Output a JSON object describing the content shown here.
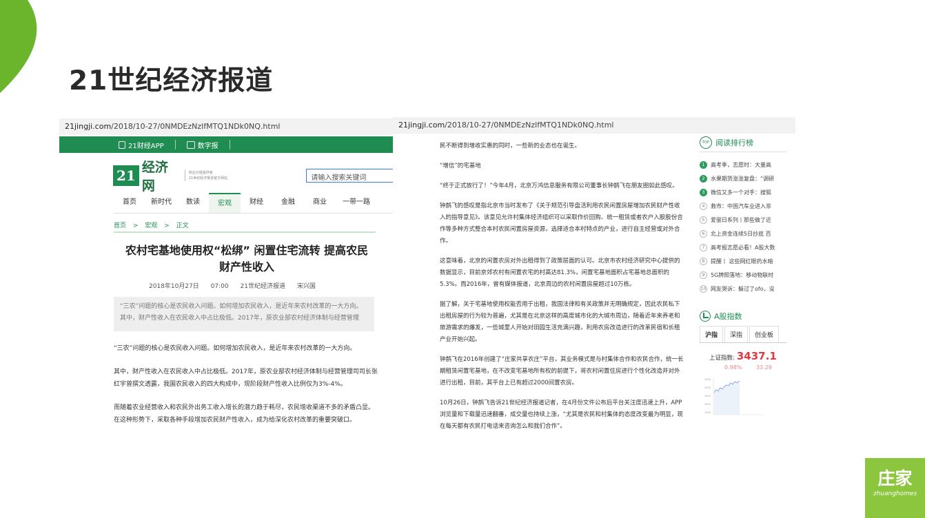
{
  "colors": {
    "accent_green": "#1f8d52",
    "corner_green": "#6bb52d",
    "brand_green": "#8cc63f",
    "index_red": "#e0393e"
  },
  "slide": {
    "title": "21世纪经济报道"
  },
  "left_shot": {
    "url_domain": "21jingji.com",
    "url_path": "/2018/10-27/0NMDEzNzlfMTQ1NDk0NQ.html",
    "topbar": {
      "app_label": "21财经APP",
      "paper_label": "数字报",
      "app_icon": "phone-icon",
      "paper_icon": "newspaper-icon"
    },
    "logo": {
      "mark": "21",
      "text": "经济网",
      "sub_line1": "商业价值提供者",
      "sub_line2": "21世纪经济报道官方网站"
    },
    "search": {
      "placeholder": "请输入搜索关键词"
    },
    "nav": [
      "首页",
      "新时代",
      "数读",
      "宏观",
      "财经",
      "金融",
      "商业",
      "一带一路"
    ],
    "nav_active": "宏观",
    "breadcrumb": [
      "首页",
      ">",
      "宏观",
      ">",
      "正文"
    ],
    "article": {
      "title": "农村宅基地使用权“松绑” 闲置住宅流转 提高农民财产性收入",
      "date": "2018年10月27日",
      "time": "07:00",
      "source": "21世纪经济报道",
      "author": "宋兴国",
      "summary": "“三农”问题的核心是农民收入问题。如何增加农民收入，是近年来农村改革的一大方向。其中，财产性收入在农民收入中占比极低。2017年，原农业部农村经济体制与经营管理",
      "paragraphs": [
        "“三农”问题的核心是农民收入问题。如何增加农民收入，是近年来农村改革的一大方向。",
        "其中，财产性收入在农民收入中占比极低。2017年，原农业部农村经济体制与经营管理司司长张红宇曾撰文透露，我国农民收入的四大构成中，现阶段财产性收入比例仅为3%-4%。",
        "而随着农业经营收入和农民外出务工收入增长的潜力趋于耗尽，农民增收渠道不多的矛盾凸显。在这种形势下，采取各种手段增加农民财产性收入，成为给深化农村改革的重要突破口。"
      ]
    }
  },
  "right_shot": {
    "url_domain": "21jingji.com",
    "url_path": "/2018/10-27/0NMDEzNzlfMTQ1NDk0NQ.html",
    "paragraphs": [
      "民不断得到增收实惠的同时，一些新的业态也在诞生。",
      "“增信”的宅基地",
      "“终于正式放行了！”今年4月，北京万鸿信息服务有限公司董事长钟鹊飞在朋友圈如此感叹。",
      "钟鹊飞的感叹是指北京市当时发布了《关于规范引导盘活利用农民闲置房屋增加农民财产性收入的指导意见》。该意见允许村集体经济组织可以采取作价回购、统一租赁或者农户入股股份合作等多种方式整合本村农民闲置房屋资源，选择适合本村特点的产业，进行自主经营或对外合作。",
      "这意味着，北京的闲置农房对外出租得到了政策层面的认可。北京市农村经济研究中心提供的数据显示，目前京郊农村有闲置农宅的村高达81.3%，闲置宅基地面积占宅基地总面积的5.3%。而2016年，曾有媒体报道，北京周边的农村闲置房屋超过10万栋。",
      "据了解，关于宅基地使用权能否用于出租，我国法律和有关政策并无明确规定，因此农民私下出租房屋的行为较为普遍，尤其是在北京这样的高度城市化的大城市周边，随着近年来养老和旅游需求的爆发，一些城里人开始对田园生活充满兴趣，利用农房改造进行的改革民宿和长租产业开始兴起。",
      "钟鹊飞在2016年创建了“庄家共享农庄”平台，其业务模式是与村集体合作和农民合作，统一长期租赁闲置宅基地，在不改变宅基地所有权的前提下，将农村闲置住房进行个性化改造并对外进行出租，目前，其平台上已有超过2000间置农房。",
      "10月26日，钟鹊飞告诉21世纪经济报道记者，在4月份文件公布后平台关注度迅速上升，APP浏览量和下载量迅速翻番，成交量也持续上涨，“尤其是农民和村集体的态度改变最为明显，现在每天都有农民打电话来咨询怎么和我们合作”。"
    ],
    "sidebar": {
      "rank_icon_text": "TOP",
      "rank_title": "阅读排行榜",
      "ranks": [
        {
          "no": "1",
          "text": "高考季，志愿时：大量高"
        },
        {
          "no": "2",
          "text": "水果期货涨涨复盘：“调研"
        },
        {
          "no": "3",
          "text": "微信又多一个对手：搜狐"
        },
        {
          "no": "4",
          "text": "救市：中国汽车业进入非"
        },
        {
          "no": "5",
          "text": "爱丽日系列丨那些做了近"
        },
        {
          "no": "6",
          "text": "北上资金连续5日抄底 百"
        },
        {
          "no": "7",
          "text": "高考报志愿必看！A股大数"
        },
        {
          "no": "8",
          "text": "提醒丨 这些网红眼药水暗"
        },
        {
          "no": "9",
          "text": "5G牌照落地：移动物联时"
        },
        {
          "no": "10",
          "text": "网友哭诉：躲过了ofo，没"
        }
      ],
      "a_share_title": "A股指数",
      "a_share_icon": "chart-icon",
      "tabs": [
        "沪指",
        "深指",
        "创业板"
      ],
      "active_tab": "沪指",
      "index_label": "上证指数:",
      "index_value": "3437.1",
      "index_change_pct": "0.98%",
      "index_change": "33.29",
      "mini_chart": {
        "y_labels": [
          "3440",
          "3430",
          "3420",
          "3410",
          "3400"
        ]
      }
    }
  },
  "brand": {
    "name": "庄家",
    "sub": "zhuanghomes"
  }
}
